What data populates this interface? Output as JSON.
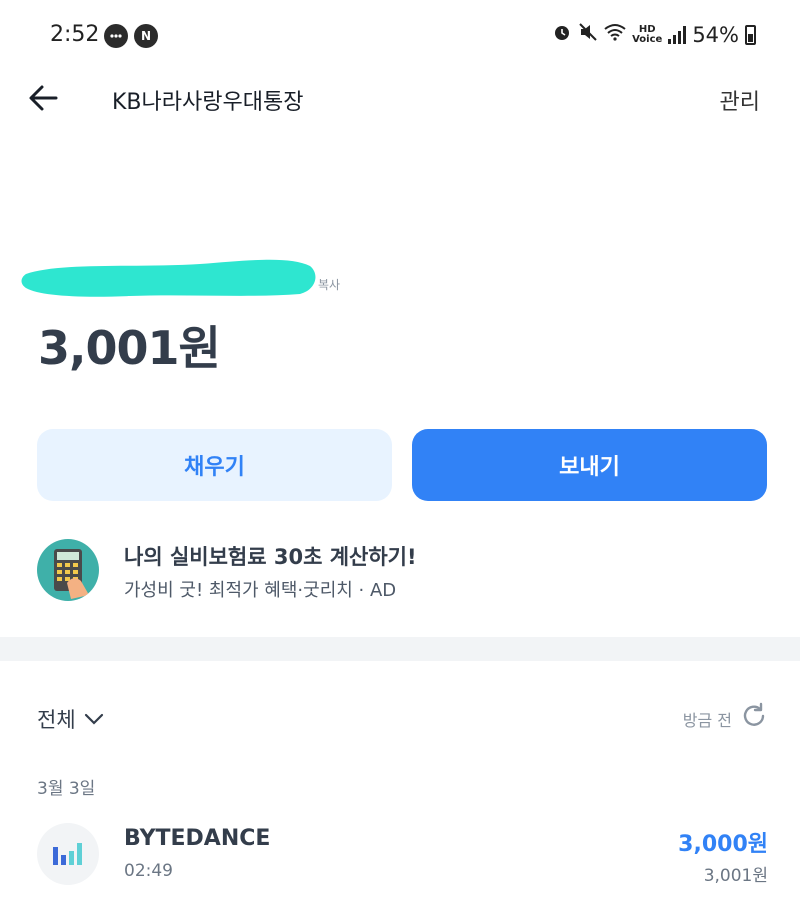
{
  "status_bar": {
    "time": "2:52",
    "battery": "54%",
    "hd_top": "HD",
    "hd_bottom": "Voice",
    "icons": [
      "message-icon",
      "naver-icon",
      "alarm-icon",
      "mute-icon",
      "wifi-icon",
      "signal-icon",
      "battery-icon"
    ]
  },
  "header": {
    "title": "KB나라사랑우대통장",
    "manage_label": "관리"
  },
  "account": {
    "copy_label": "복사",
    "balance": "3,001원"
  },
  "actions": {
    "fill_label": "채우기",
    "send_label": "보내기"
  },
  "ad": {
    "title": "나의 실비보험료 30초 계산하기!",
    "subtitle": "가성비 굿! 최적가 혜택·굿리치 · AD"
  },
  "history": {
    "filter_label": "전체",
    "refresh_label": "방금 전",
    "date": "3월 3일",
    "transactions": [
      {
        "name": "BYTEDANCE",
        "time": "02:49",
        "amount": "3,000원",
        "balance_after": "3,001원"
      }
    ]
  },
  "colors": {
    "primary": "#3182f6",
    "primary_light": "#e8f3ff",
    "redaction": "#2ee6d0",
    "text_main": "#333d4b",
    "text_sub": "#6b7684"
  }
}
